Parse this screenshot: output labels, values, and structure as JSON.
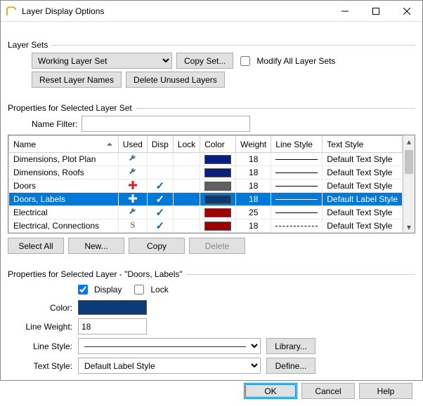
{
  "window": {
    "title": "Layer Display Options"
  },
  "layerSets": {
    "legend": "Layer Sets",
    "workingSet": "Working Layer Set",
    "copySet": "Copy Set...",
    "modifyAll": "Modify All Layer Sets",
    "modifyAllChecked": false,
    "resetNames": "Reset Layer Names",
    "deleteUnused": "Delete Unused Layers"
  },
  "selectedSet": {
    "legend": "Properties for Selected Layer Set",
    "nameFilterLabel": "Name Filter:",
    "nameFilterValue": "",
    "columns": {
      "name": "Name",
      "used": "Used",
      "disp": "Disp",
      "lock": "Lock",
      "color": "Color",
      "weight": "Weight",
      "lineStyle": "Line Style",
      "textStyle": "Text Style"
    },
    "rows": [
      {
        "name": "Dimensions, Plot Plan",
        "used": "wrench",
        "disp": false,
        "lock": false,
        "color": "#0a1e7c",
        "weight": "18",
        "lineStyle": "solid",
        "textStyle": "Default Text Style",
        "selected": false
      },
      {
        "name": "Dimensions, Roofs",
        "used": "wrench",
        "disp": false,
        "lock": false,
        "color": "#0a1e7c",
        "weight": "18",
        "lineStyle": "solid",
        "textStyle": "Default Text Style",
        "selected": false
      },
      {
        "name": "Doors",
        "used": "plus-red",
        "disp": true,
        "lock": false,
        "color": "#606060",
        "weight": "18",
        "lineStyle": "solid",
        "textStyle": "Default Text Style",
        "selected": false
      },
      {
        "name": "Doors, Labels",
        "used": "plus-white",
        "disp": true,
        "lock": false,
        "color": "#0a3a78",
        "weight": "18",
        "lineStyle": "solid",
        "textStyle": "Default Label Style",
        "selected": true
      },
      {
        "name": "Electrical",
        "used": "wrench",
        "disp": true,
        "lock": false,
        "color": "#a00000",
        "weight": "25",
        "lineStyle": "solid",
        "textStyle": "Default Text Style",
        "selected": false
      },
      {
        "name": "Electrical, Connections",
        "used": "s",
        "disp": true,
        "lock": false,
        "color": "#a00000",
        "weight": "18",
        "lineStyle": "dashed",
        "textStyle": "Default Text Style",
        "selected": false
      }
    ],
    "buttons": {
      "selectAll": "Select All",
      "new": "New...",
      "copy": "Copy",
      "delete": "Delete"
    }
  },
  "selectedLayer": {
    "legend": "Properties for Selected Layer - \"Doors, Labels\"",
    "displayLabel": "Display",
    "displayChecked": true,
    "lockLabel": "Lock",
    "lockChecked": false,
    "colorLabel": "Color:",
    "colorValue": "#0a3a78",
    "lineWeightLabel": "Line Weight:",
    "lineWeightValue": "18",
    "lineStyleLabel": "Line Style:",
    "libraryBtn": "Library...",
    "textStyleLabel": "Text Style:",
    "textStyleValue": "Default Label Style",
    "defineBtn": "Define..."
  },
  "dialogButtons": {
    "ok": "OK",
    "cancel": "Cancel",
    "help": "Help"
  }
}
